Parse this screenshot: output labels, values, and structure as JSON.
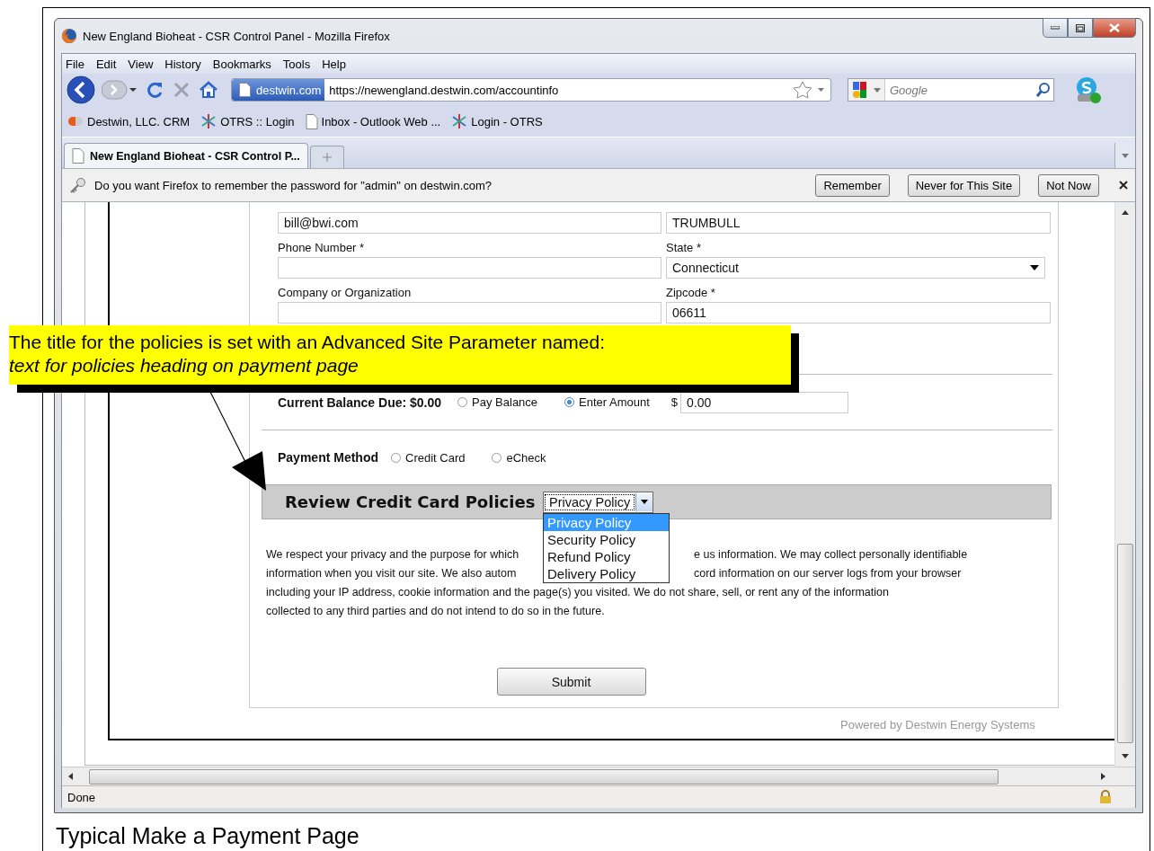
{
  "window": {
    "title": "New England Bioheat - CSR Control Panel - Mozilla Firefox"
  },
  "menu": [
    "File",
    "Edit",
    "View",
    "History",
    "Bookmarks",
    "Tools",
    "Help"
  ],
  "address_bar": {
    "site_identity": "destwin.com",
    "url": "https://newengland.destwin.com/accountinfo"
  },
  "search": {
    "placeholder": "Google"
  },
  "bookmarks": [
    {
      "label": "Destwin, LLC. CRM",
      "kind": "crm"
    },
    {
      "label": "OTRS :: Login",
      "kind": "otrs"
    },
    {
      "label": "Inbox - Outlook Web ...",
      "kind": "page"
    },
    {
      "label": "Login - OTRS",
      "kind": "otrs"
    }
  ],
  "tabs": [
    {
      "label": "New England Bioheat - CSR Control P...",
      "selected": true
    }
  ],
  "password_bar": {
    "message": "Do you want Firefox to remember the password for \"admin\" on destwin.com?",
    "buttons": [
      "Remember",
      "Never for This Site",
      "Not Now"
    ]
  },
  "form": {
    "fields": [
      [
        {
          "value": "bill@bwi.com",
          "kind": "text"
        },
        {
          "value": "TRUMBULL",
          "kind": "text"
        }
      ],
      [
        {
          "label": "Phone Number *",
          "kind": "text"
        },
        {
          "label": "State *",
          "value": "Connecticut",
          "kind": "select"
        }
      ],
      [
        {
          "label": "Company or Organization",
          "kind": "text"
        },
        {
          "label": "Zipcode *",
          "value": "06611",
          "kind": "text"
        }
      ]
    ],
    "balance": {
      "label": "Current Balance Due: $0.00",
      "options": [
        {
          "label": "Pay Balance",
          "selected": false
        },
        {
          "label": "Enter Amount",
          "selected": true
        }
      ],
      "currency": "$",
      "amount": "0.00"
    },
    "payment_method": {
      "label": "Payment Method",
      "options": [
        {
          "label": "Credit Card",
          "selected": false
        },
        {
          "label": "eCheck",
          "selected": false
        }
      ]
    },
    "policies": {
      "title": "Review Credit Card Policies",
      "value": "Privacy Policy",
      "expanded": true,
      "options": [
        {
          "label": "Privacy Policy",
          "selected": true
        },
        {
          "label": "Security Policy",
          "selected": false
        },
        {
          "label": "Refund Policy",
          "selected": false
        },
        {
          "label": "Delivery Policy",
          "selected": false
        }
      ],
      "text_lines": [
        {
          "kind": "split",
          "left": "We respect your privacy and the purpose for which",
          "right": "e us information. We may collect personally identifiable"
        },
        {
          "kind": "split",
          "left": "information when you visit our site. We also autom",
          "right": "cord information on our server logs from your browser"
        },
        {
          "kind": "full",
          "text": "including your IP address, cookie information and the page(s) you visited. We do not share, sell, or rent any of the information"
        },
        {
          "kind": "full",
          "text": "collected to any third parties and do not intend to do so in the future."
        }
      ]
    },
    "submit": "Submit",
    "footer": "Powered by Destwin Energy Systems"
  },
  "status_bar": {
    "text": "Done"
  },
  "callout": {
    "text": "The title for the policies is set with an Advanced Site Parameter named:",
    "parameter": "text for policies heading on payment page"
  },
  "caption": "Typical Make a Payment Page"
}
